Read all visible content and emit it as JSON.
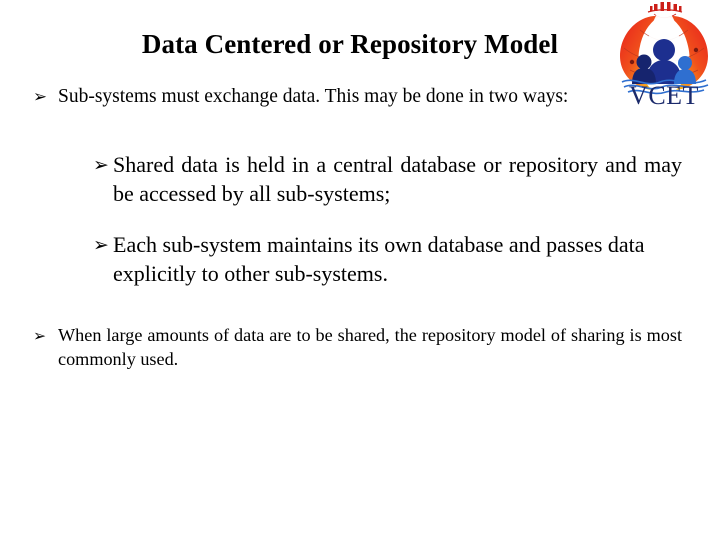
{
  "slide": {
    "title": "Data Centered or Repository Model",
    "background_color": "#ffffff",
    "text_color": "#000000"
  },
  "logo": {
    "name": "vcet-logo",
    "wordmark": "VCET",
    "colors": {
      "arc_outer": "#e8261b",
      "arc_mid": "#f57c1f",
      "arc_inner": "#fbbe1b",
      "figures": "#1d2f8f",
      "figure_small": "#2f6fd0",
      "wordmark": "#1b2a6b",
      "crown": "#cc1f18",
      "waves": "#2f6fd0"
    }
  },
  "bullets": [
    {
      "marker": "➢",
      "level": 1,
      "text": "Sub-systems must exchange data. This may be done in two ways:"
    },
    {
      "marker": "➢",
      "level": 2,
      "text": "Shared data is held in a central database or repository and may be accessed by all sub-systems;"
    },
    {
      "marker": "➢",
      "level": 2,
      "text": "Each sub-system maintains its own database and passes data explicitly to other sub-systems."
    },
    {
      "marker": "➢",
      "level": 1,
      "text": "When large amounts of data are to be shared, the repository model of sharing is most commonly used."
    }
  ]
}
